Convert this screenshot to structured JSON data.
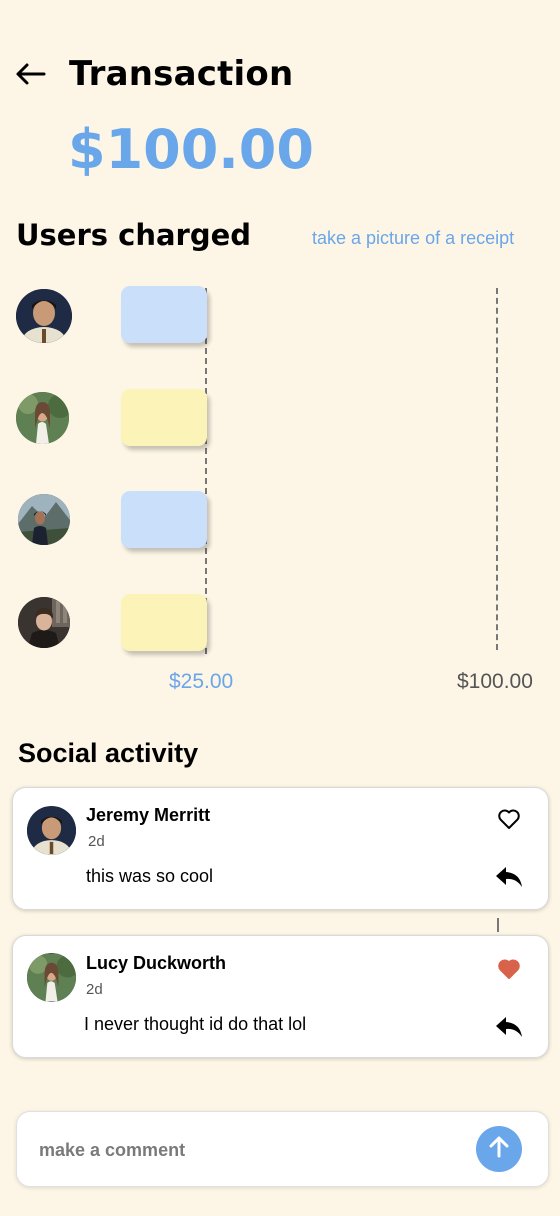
{
  "header": {
    "title": "Transaction",
    "amount": "$100.00"
  },
  "users_charged": {
    "title": "Users charged",
    "receipt_link": "take a picture of a receipt",
    "scale_labels": {
      "split": "$25.00",
      "total": "$100.00"
    },
    "users": [
      {
        "avatar": "user-photo",
        "bar_color": "#c9dffa",
        "share": 0.25
      },
      {
        "avatar": "user-photo",
        "bar_color": "#fbf3b8",
        "share": 0.25
      },
      {
        "avatar": "user-photo",
        "bar_color": "#c9dffa",
        "share": 0.25
      },
      {
        "avatar": "user-photo",
        "bar_color": "#fbf3b8",
        "share": 0.25
      }
    ]
  },
  "social": {
    "title": "Social activity",
    "posts": [
      {
        "name": "Jeremy Merritt",
        "time": "2d",
        "text": "this was so cool",
        "liked": false
      },
      {
        "name": "Lucy Duckworth",
        "time": "2d",
        "text": "I never thought id do that lol",
        "liked": true
      }
    ]
  },
  "comment": {
    "placeholder": "make a comment"
  },
  "colors": {
    "accent": "#6aa6ea",
    "background": "#fdf6e6",
    "heart_liked": "#d9624a"
  }
}
